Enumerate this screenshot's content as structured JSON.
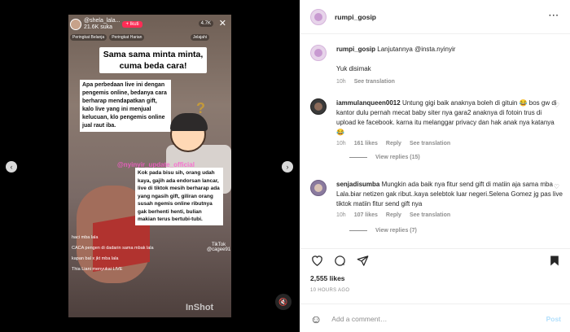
{
  "media": {
    "tiktok": {
      "username": "@shela_lala...",
      "likes_count": "21.6K suka",
      "follow_label": "+ Ikuti",
      "viewers": "4.7K",
      "close_icon": "close-icon",
      "pills": [
        "Peringkat Belanja",
        "Peringkat Harian"
      ],
      "join_pill": "Jelajahi",
      "caption_title": "Sama sama minta minta, cuma beda cara!",
      "caption_1": "Apa perbedaan live ini dengan pengemis online, bedanya cara berharap mendapatkan gift, kalo live yang ini menjual kelucuan, klo pengemis online jual raut iba.",
      "watermark": "@nyinyir_update_official",
      "caption_2": "Kok pada bisu sih, orang udah kaya, gajih ada endorsan lancar, live di tiktok mesih berharap ada yang ngasih gift, giliran orang susah ngemis online ributnya gak berhenti henti, bulian makian terus bertubi-tubi.",
      "comments": [
        "haci mba lala",
        "CACA pengen di dadarin sama mbak lala",
        "kapan bal x jkt mba lala",
        "Thia Liani menyukai LIVE"
      ],
      "tiktok_label": "TikTok",
      "tiktok_handle": "@cagee91"
    },
    "inshot": "InShot",
    "mute_icon": "mute-icon",
    "prev_icon": "chevron-left-icon",
    "next_icon": "chevron-right-icon"
  },
  "header": {
    "username": "rumpi_gosip",
    "more_icon": "more-icon"
  },
  "caption": {
    "username": "rumpi_gosip",
    "text": "Lanjutannya @insta.nyinyir",
    "line2": "Yuk disimak",
    "time": "10h",
    "see_translation": "See translation"
  },
  "comments": [
    {
      "username": "iammulanqueen0012",
      "text": "Untung gigi baik anaknya boleh di gituin 😂 bos gw di kantor dulu pernah mecat baby siter nya gara2 anaknya di fotoin trus di upload ke facebook. karna itu melanggar privacy dan hak anak nya katanya 😂",
      "time": "10h",
      "likes": "161 likes",
      "reply": "Reply",
      "see_translation": "See translation",
      "view_replies": "View replies (15)"
    },
    {
      "username": "senjadisumba",
      "text": "Mungkin ada baik nya fitur send gift di matiin aja sama mba Lala.biar netizen gak ribut..kaya selebtok luar negeri.Selena Gomez jg pas live tiktok matiin fitur send gift nya",
      "time": "10h",
      "likes": "107 likes",
      "reply": "Reply",
      "see_translation": "See translation",
      "view_replies": "View replies (7)"
    }
  ],
  "actions": {
    "likes": "2,555 likes",
    "ago": "10 HOURS AGO",
    "add_comment_placeholder": "Add a comment…",
    "post_label": "Post"
  }
}
